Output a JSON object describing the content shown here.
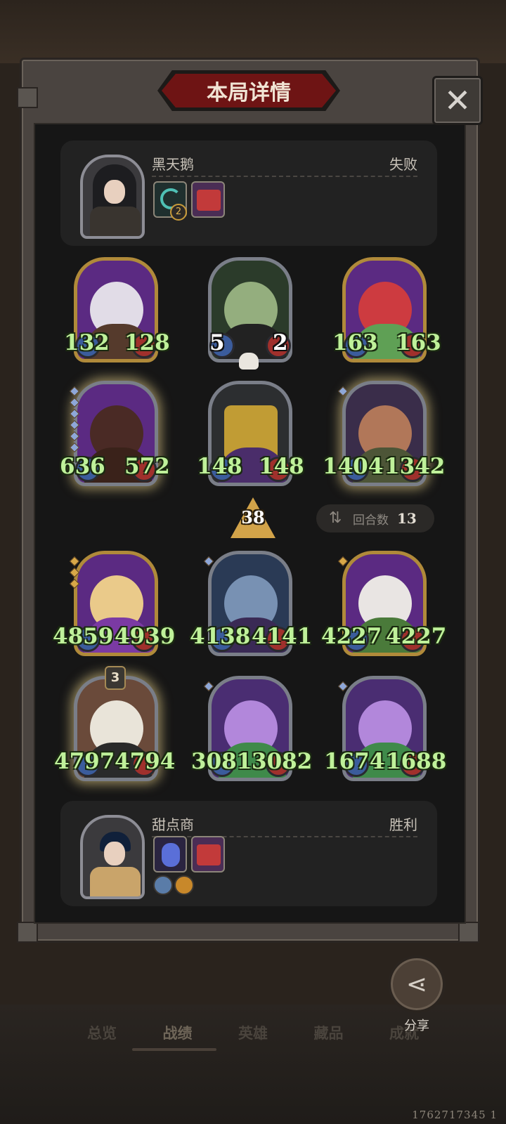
{
  "dialog": {
    "title": "本局详情",
    "close_icon": "close-icon"
  },
  "opponent": {
    "name": "黑天鹅",
    "result": "失败",
    "item_badge": "2"
  },
  "player": {
    "name": "甜点商",
    "result": "胜利"
  },
  "opponent_heroes": [
    {
      "atk": "132",
      "hp": "128"
    },
    {
      "atk": "5",
      "hp": "2"
    },
    {
      "atk": "163",
      "hp": "163"
    },
    {
      "atk": "636",
      "hp": "572"
    },
    {
      "atk": "148",
      "hp": "148"
    },
    {
      "atk": "1404",
      "hp": "1342"
    }
  ],
  "player_heroes": [
    {
      "atk": "4859",
      "hp": "4939"
    },
    {
      "atk": "4138",
      "hp": "4141"
    },
    {
      "atk": "4227",
      "hp": "4227"
    },
    {
      "atk": "4797",
      "hp": "4794",
      "level": "3"
    },
    {
      "atk": "3081",
      "hp": "3082"
    },
    {
      "atk": "1674",
      "hp": "1688"
    }
  ],
  "tavern_tier": "38",
  "rounds": {
    "label": "回合数",
    "value": "13"
  },
  "share": {
    "label": "分享"
  },
  "tabs": [
    "总览",
    "战绩",
    "英雄",
    "藏品",
    "成就"
  ],
  "footer_id": "1762717345 1",
  "colors": {
    "stat_green": "#bff19a",
    "title_red": "#6e1414",
    "gold": "#d2a349"
  }
}
